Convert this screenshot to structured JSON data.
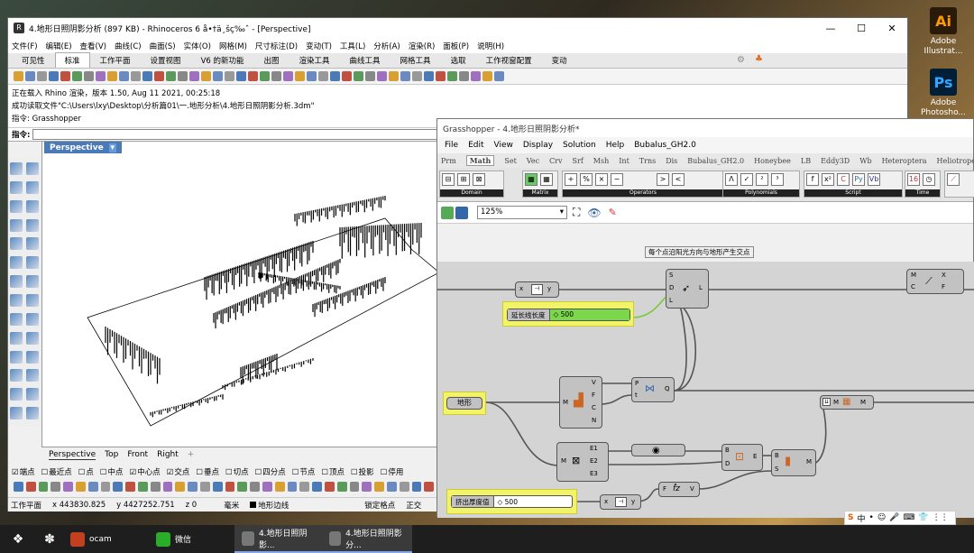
{
  "desktop": {
    "icons": [
      {
        "name": "Adobe Illustrat...",
        "glyph": "Ai",
        "color": "#2a1a0a",
        "fg": "#ff9a00"
      },
      {
        "name": "Adobe Photosho...",
        "glyph": "Ps",
        "color": "#001e36",
        "fg": "#31a8ff"
      }
    ]
  },
  "rhino": {
    "title": "4.地形日照阴影分析 (897 KB) - Rhinoceros 6 å•†ä¸šç‰ˆ - [Perspective]",
    "window_buttons": [
      "—",
      "☐",
      "✕"
    ],
    "menu": [
      "文件(F)",
      "编辑(E)",
      "查看(V)",
      "曲线(C)",
      "曲面(S)",
      "实体(O)",
      "网格(M)",
      "尺寸标注(D)",
      "变动(T)",
      "工具(L)",
      "分析(A)",
      "渲染(R)",
      "面板(P)",
      "说明(H)"
    ],
    "tabs": [
      "可见性",
      "标准",
      "工作平面",
      "设置视图",
      "V6 的新功能",
      "出图",
      "渲染工具",
      "曲线工具",
      "网格工具",
      "选取",
      "工作视窗配置",
      "变动"
    ],
    "active_tab": "标准",
    "command_history": [
      "正在载入 Rhino 渲染，版本 1.50, Aug 11 2021, 00:25:18",
      "成功读取文件\"C:\\Users\\lxy\\Desktop\\分析篇01\\一.地形分析\\4.地形日照阴影分析.3dm\"",
      "指令: Grasshopper"
    ],
    "command_prompt": "指令:",
    "viewport_label": "Perspective",
    "view_tabs": [
      "Perspective",
      "Top",
      "Front",
      "Right",
      "+"
    ],
    "osnaps": [
      {
        "label": "端点",
        "checked": true
      },
      {
        "label": "最近点",
        "checked": false
      },
      {
        "label": "点",
        "checked": false
      },
      {
        "label": "中点",
        "checked": false
      },
      {
        "label": "中心点",
        "checked": true
      },
      {
        "label": "交点",
        "checked": true
      },
      {
        "label": "垂点",
        "checked": false
      },
      {
        "label": "切点",
        "checked": false
      },
      {
        "label": "四分点",
        "checked": false
      },
      {
        "label": "节点",
        "checked": false
      },
      {
        "label": "顶点",
        "checked": false
      },
      {
        "label": "投影",
        "checked": false
      },
      {
        "label": "停用",
        "checked": false
      }
    ],
    "status": {
      "plane": "工作平面",
      "x": "x 443830.825",
      "y": "y 4427252.751",
      "z": "z 0",
      "unit": "毫米",
      "layer": "地形边线",
      "grid": "锁定格点",
      "ortho": "正交"
    }
  },
  "grasshopper": {
    "title": "Grasshopper - 4.地形日照阴影分析*",
    "menu": [
      "File",
      "Edit",
      "View",
      "Display",
      "Solution",
      "Help",
      "Bubalus_GH2.0"
    ],
    "ribbon_tabs": [
      "Prm",
      "Math",
      "Set",
      "Vec",
      "Crv",
      "Srf",
      "Msh",
      "Int",
      "Trns",
      "Dis",
      "Bubalus_GH2.0",
      "Honeybee",
      "LB",
      "Eddy3D",
      "Wb",
      "Heteroptera",
      "Heliotrope",
      "Lt",
      "D"
    ],
    "active_ribbon_tab": "Math",
    "groups": [
      "Domain",
      "Matrix",
      "Operators",
      "Polynomials",
      "Script",
      "Time"
    ],
    "zoom": "125%",
    "group_title": "每个点沿阳光方向与地形产生交点",
    "sliders": [
      {
        "label": "延长线长度",
        "value": "◇ 500"
      },
      {
        "label": "挤出厚度值",
        "value": "◇ 500"
      }
    ],
    "param_label": "地形",
    "components": {
      "xy": {
        "in": "x",
        "out": "y"
      },
      "line": {
        "inputs": [
          "S",
          "D",
          "L"
        ],
        "output": "L"
      },
      "intersect": {
        "inputs": [
          "M",
          "C"
        ],
        "outputs": [
          "X",
          "F"
        ]
      },
      "brep": {
        "in": "M",
        "outputs": [
          "V",
          "F",
          "C",
          "N"
        ]
      },
      "pt": {
        "inputs": [
          "P",
          "t"
        ],
        "output": "Q"
      },
      "mesh": {
        "in": "M",
        "out": "M"
      },
      "explode": {
        "in": "M",
        "outputs": [
          "E1",
          "E2",
          "E3"
        ]
      },
      "boundary": {
        "inputs": [
          "B",
          "D"
        ],
        "output": "E"
      },
      "merge": {
        "inputs": [
          "B",
          "S"
        ],
        "output": "M"
      },
      "unitz": {
        "in": "F",
        "out": "V"
      },
      "xy2": {
        "in": "x",
        "out": "y"
      }
    }
  },
  "taskbar": {
    "items": [
      {
        "label": "ocam",
        "color": "#c04020"
      },
      {
        "label": "微信",
        "color": "#2aae2a"
      },
      {
        "label": "4.地形日照阴影...",
        "color": "#777"
      },
      {
        "label": "4.地形日照阴影分...",
        "color": "#777"
      }
    ]
  },
  "tray": [
    "S",
    "中",
    "•",
    "☺",
    "🎤",
    "⌨",
    "👕",
    "⋮⋮"
  ]
}
